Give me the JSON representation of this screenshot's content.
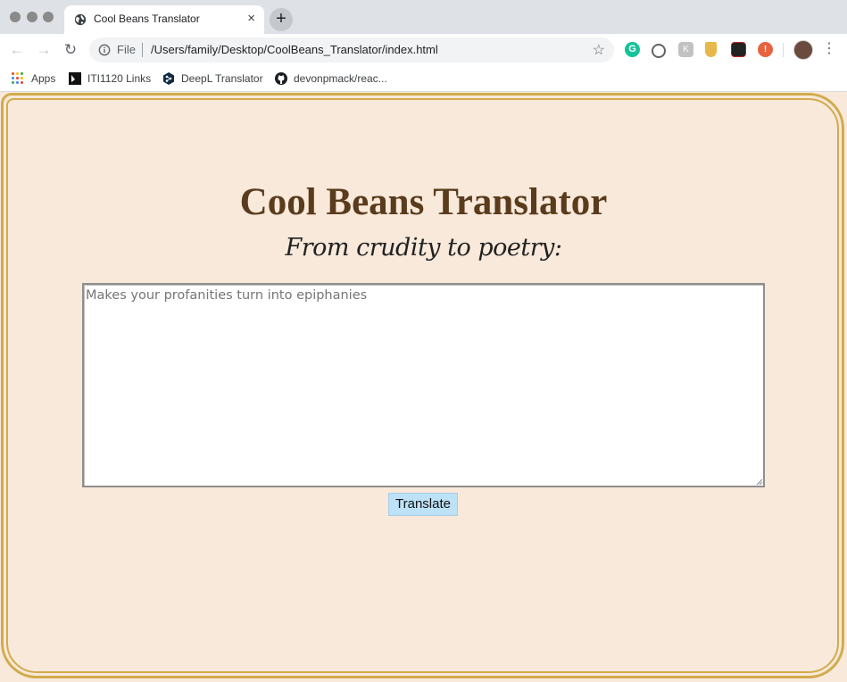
{
  "browser": {
    "tab_title": "Cool Beans Translator",
    "tab_close": "×",
    "new_tab": "+",
    "address_scheme": "File",
    "address_url": "/Users/family/Desktop/CoolBeans_Translator/index.html",
    "extensions": [
      {
        "name": "grammarly-icon",
        "glyph": "G"
      },
      {
        "name": "extension-2-icon",
        "glyph": ""
      },
      {
        "name": "extension-3-icon",
        "glyph": "K"
      },
      {
        "name": "extension-4-icon",
        "glyph": ""
      },
      {
        "name": "extension-5-icon",
        "glyph": ""
      },
      {
        "name": "extension-6-icon",
        "glyph": "!"
      }
    ]
  },
  "bookmarks": [
    {
      "label": "Apps",
      "icon": "apps-grid-icon"
    },
    {
      "label": "ITI1120 Links",
      "icon": "iti-bookmark-icon"
    },
    {
      "label": "DeepL Translator",
      "icon": "deepl-icon"
    },
    {
      "label": "devonpmack/reac...",
      "icon": "github-icon"
    }
  ],
  "page": {
    "title": "Cool Beans Translator",
    "subtitle": "From crudity to poetry:",
    "input_placeholder": "Makes your profanities turn into epiphanies",
    "input_value": "",
    "button_label": "Translate"
  },
  "colors": {
    "page_background": "#f8e9db",
    "frame_gold": "#d2ab4d",
    "title_brown": "#5a3b1c",
    "button_blue": "#bde1f7"
  }
}
